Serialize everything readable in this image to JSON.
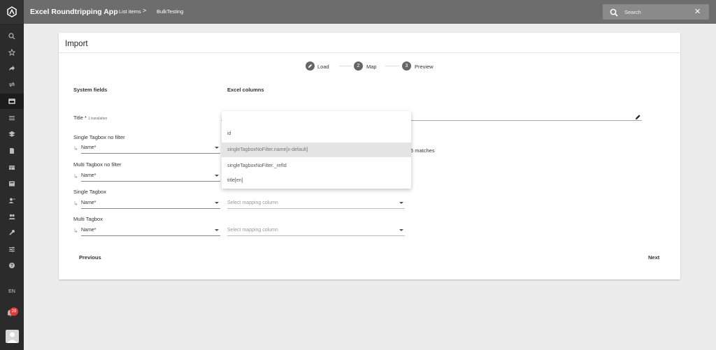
{
  "app": {
    "title": "Excel Roundtripping App"
  },
  "breadcrumb": {
    "items": [
      "List items",
      "BulkTesting"
    ],
    "separator": ">"
  },
  "search": {
    "placeholder": "Search"
  },
  "sidebar": {
    "lang": "EN",
    "notifications": "29",
    "icons": [
      "search-icon",
      "star-icon",
      "share-icon",
      "sync-icon",
      "window-icon",
      "list-icon",
      "layers-icon",
      "document-icon",
      "table-icon",
      "id-card-icon",
      "person-icon",
      "people-icon",
      "wrench-icon",
      "sliders-icon",
      "help-icon"
    ]
  },
  "card": {
    "title": "Import"
  },
  "stepper": {
    "steps": [
      {
        "label": "Load",
        "num": ""
      },
      {
        "label": "Map",
        "num": "2"
      },
      {
        "label": "Preview",
        "num": "3"
      }
    ]
  },
  "columns": {
    "system": "System fields",
    "excel": "Excel columns"
  },
  "fields": {
    "title": {
      "label": "Title *",
      "note": "1 translation"
    },
    "single_nofilter": {
      "label": "Single Tagbox no filter",
      "sub": "Name*"
    },
    "multi_nofilter": {
      "label": "Multi Tagbox no filter",
      "sub": "Name*"
    },
    "single": {
      "label": "Single Tagbox",
      "sub": "Name*",
      "mapping": "Select mapping column"
    },
    "multi": {
      "label": "Multi Tagbox",
      "sub": "Name*",
      "mapping": "Select mapping column"
    }
  },
  "matches": "5 matches",
  "dropdown": {
    "options": [
      "id",
      "singleTagboxNoFilter.name[x-default]",
      "singleTagboxNoFilter._refId",
      "title[en]"
    ],
    "selected_index": 1
  },
  "buttons": {
    "previous": "Previous",
    "next": "Next"
  }
}
